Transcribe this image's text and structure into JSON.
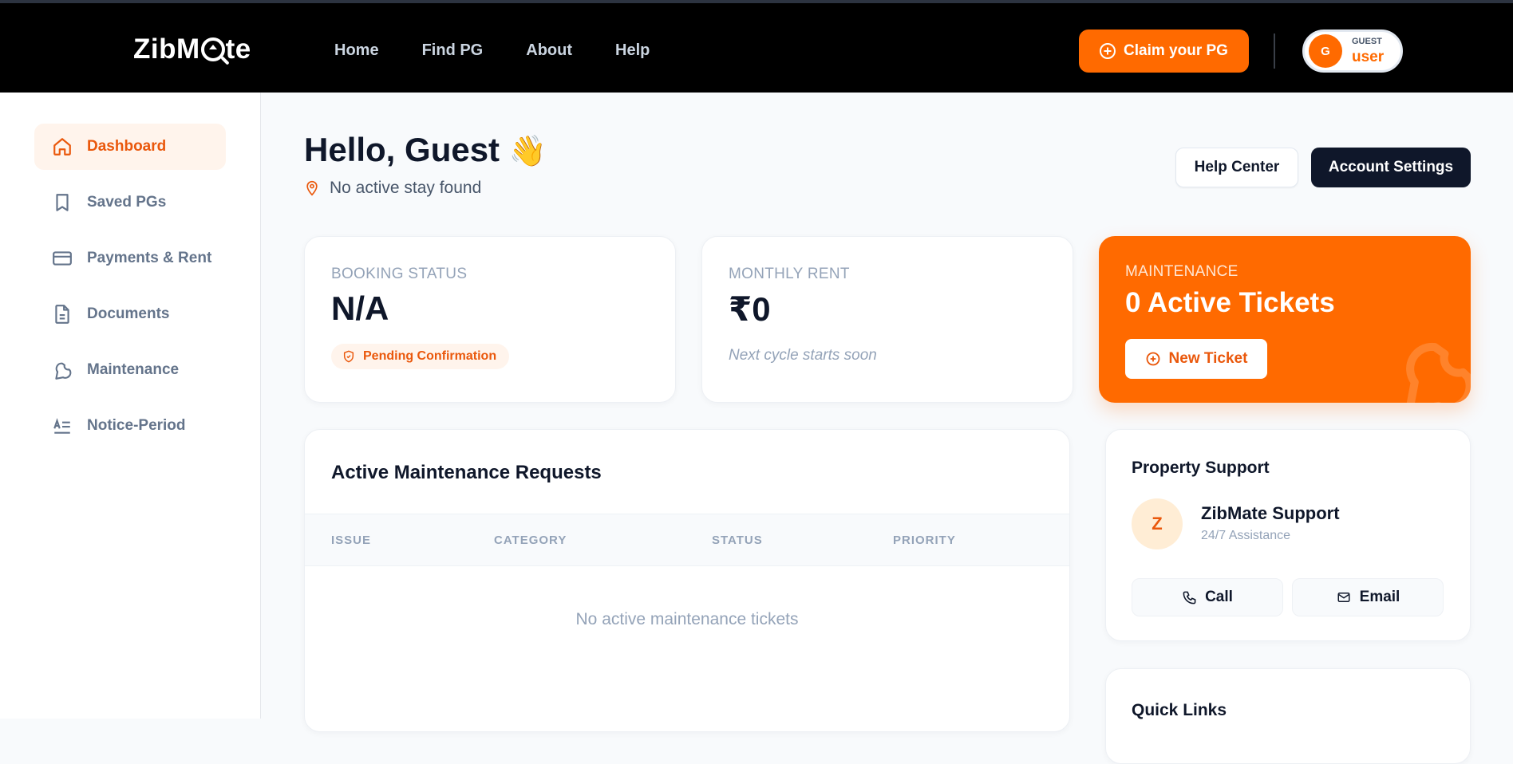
{
  "brand": {
    "name_left": "ZibM",
    "name_right": "te"
  },
  "nav": {
    "items": [
      "Home",
      "Find PG",
      "About",
      "Help"
    ]
  },
  "header": {
    "claim_label": "Claim your PG",
    "user_initial": "G",
    "user_role": "GUEST",
    "user_name": "user"
  },
  "sidebar": {
    "items": [
      {
        "label": "Dashboard",
        "icon": "home-icon",
        "active": true
      },
      {
        "label": "Saved PGs",
        "icon": "bookmark-icon"
      },
      {
        "label": "Payments & Rent",
        "icon": "credit-card-icon"
      },
      {
        "label": "Documents",
        "icon": "document-icon"
      },
      {
        "label": "Maintenance",
        "icon": "wrench-icon"
      },
      {
        "label": "Notice-Period",
        "icon": "notice-icon"
      }
    ]
  },
  "main": {
    "greeting": "Hello, Guest",
    "wave": "👋",
    "location": "No active stay found",
    "help_center": "Help Center",
    "account_settings": "Account Settings"
  },
  "stats": {
    "booking": {
      "label": "BOOKING STATUS",
      "value": "N/A",
      "badge": "Pending Confirmation"
    },
    "rent": {
      "label": "MONTHLY RENT",
      "value": "₹0",
      "note": "Next cycle starts soon"
    },
    "maintenance": {
      "label": "MAINTENANCE",
      "value": "0 Active Tickets",
      "button": "New Ticket"
    }
  },
  "requests": {
    "title": "Active Maintenance Requests",
    "columns": [
      "ISSUE",
      "CATEGORY",
      "STATUS",
      "PRIORITY"
    ],
    "empty": "No active maintenance tickets"
  },
  "support": {
    "title": "Property Support",
    "initial": "Z",
    "name": "ZibMate Support",
    "subtitle": "24/7 Assistance",
    "call": "Call",
    "email": "Email"
  },
  "quick_links": {
    "title": "Quick Links"
  },
  "colors": {
    "accent": "#ff6a00",
    "dark": "#0f172a",
    "topbar": "#000000"
  }
}
